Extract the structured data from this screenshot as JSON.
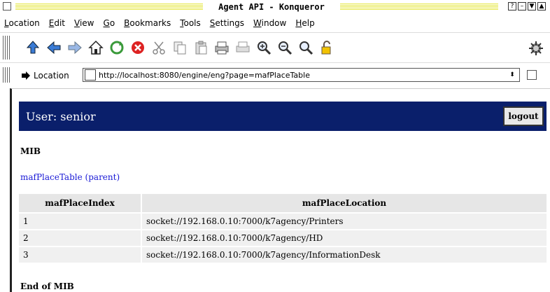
{
  "window": {
    "title": "Agent API - Konqueror",
    "controls": [
      "?",
      "–",
      "▼",
      "▲"
    ]
  },
  "menu": [
    "Location",
    "Edit",
    "View",
    "Go",
    "Bookmarks",
    "Tools",
    "Settings",
    "Window",
    "Help"
  ],
  "toolbar": {
    "icons": [
      "up-icon",
      "back-icon",
      "forward-icon",
      "home-icon",
      "reload-icon",
      "stop-icon",
      "cut-icon",
      "copy-icon",
      "paste-icon",
      "print-icon",
      "print-frame-icon",
      "zoom-in-icon",
      "zoom-out-icon",
      "find-icon",
      "security-icon",
      "konqueror-logo-icon"
    ]
  },
  "location": {
    "label": "Location",
    "url": "http://localhost:8080/engine/eng?page=mafPlaceTable"
  },
  "page": {
    "user_label": "User: senior",
    "logout_label": "logout",
    "mib_heading": "MIB",
    "table_link": "mafPlaceTable",
    "parent_link": "(parent)",
    "end_heading": "End of MIB",
    "colors": {
      "header_bg": "#0a1f6b",
      "link": "#1a1ad6"
    }
  },
  "table": {
    "headers": [
      "mafPlaceIndex",
      "mafPlaceLocation"
    ],
    "rows": [
      [
        "1",
        "socket://192.168.0.10:7000/k7agency/Printers"
      ],
      [
        "2",
        "socket://192.168.0.10:7000/k7agency/HD"
      ],
      [
        "3",
        "socket://192.168.0.10:7000/k7agency/InformationDesk"
      ]
    ]
  }
}
